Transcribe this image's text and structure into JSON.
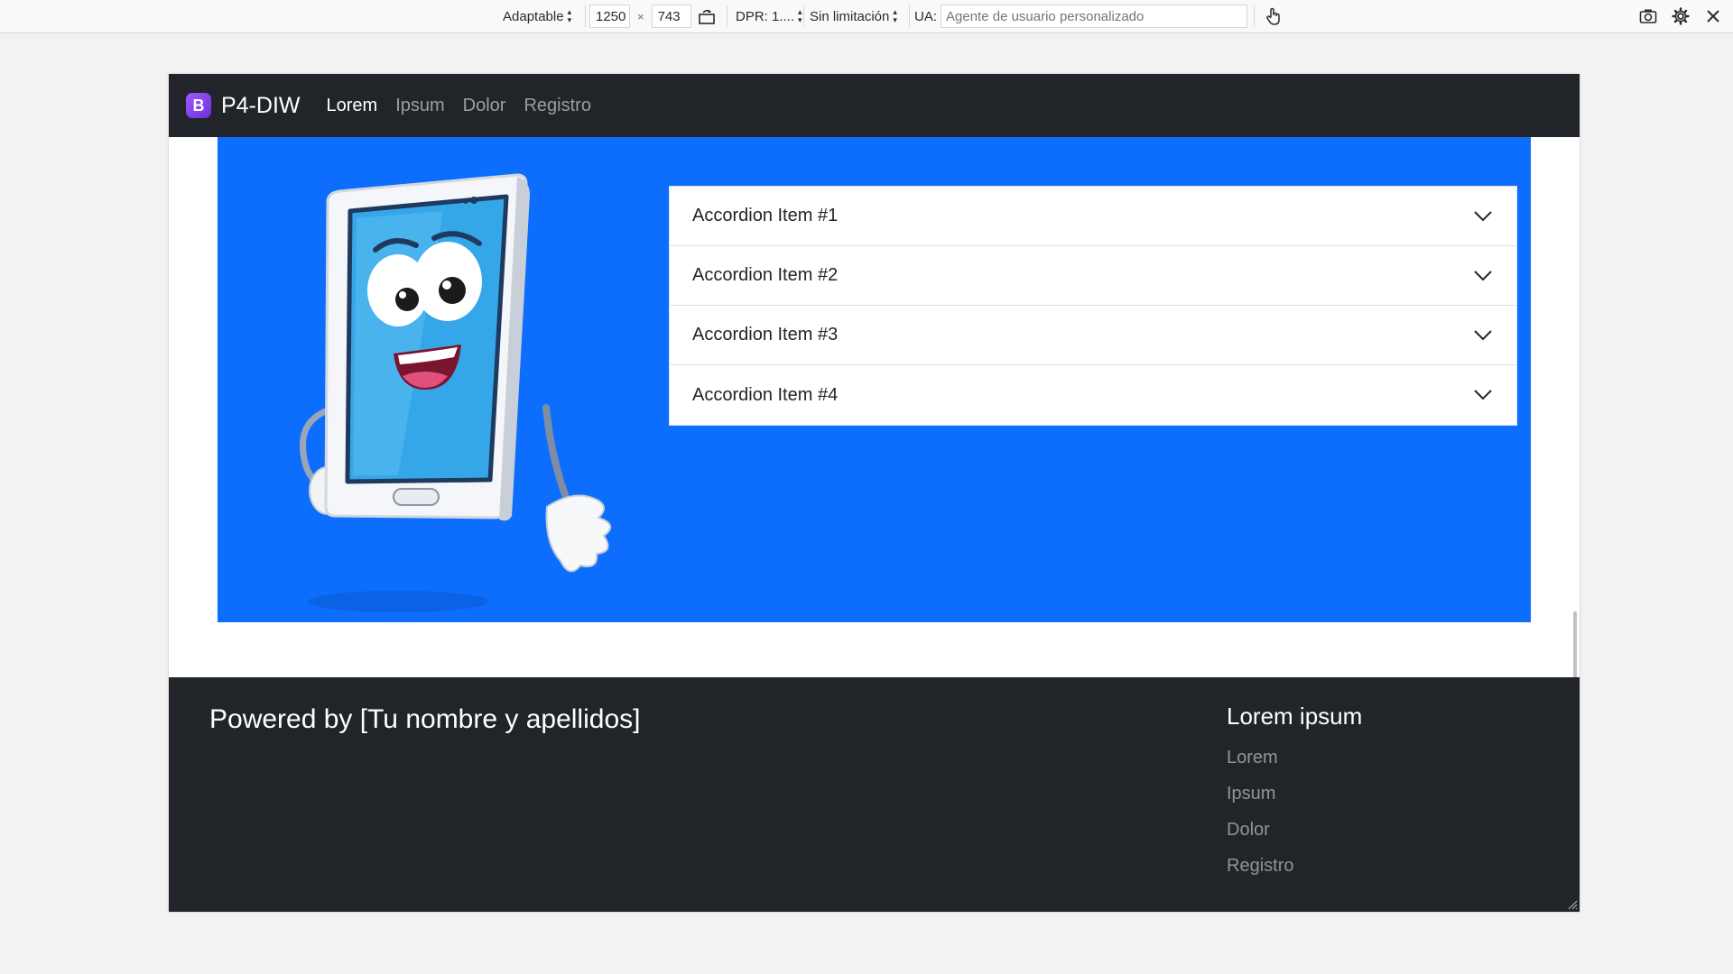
{
  "toolbar": {
    "device_mode": "Adaptable",
    "width": "1250",
    "times": "×",
    "height": "743",
    "dpr": "DPR: 1....",
    "throttling": "Sin limitación",
    "ua_label": "UA:",
    "ua_placeholder": "Agente de usuario personalizado",
    "icons": [
      "rotate-icon",
      "touch-icon",
      "screenshot-icon",
      "settings-icon",
      "close-icon"
    ]
  },
  "navbar": {
    "brand_logo": "B",
    "brand": "P4-DIW",
    "links": [
      {
        "label": "Lorem",
        "active": true
      },
      {
        "label": "Ipsum",
        "active": false
      },
      {
        "label": "Dolor",
        "active": false
      },
      {
        "label": "Registro",
        "active": false
      }
    ]
  },
  "hero": {
    "background": "#0d6efd",
    "accordion": [
      {
        "label": "Accordion Item #1"
      },
      {
        "label": "Accordion Item #2"
      },
      {
        "label": "Accordion Item #3"
      },
      {
        "label": "Accordion Item #4"
      }
    ]
  },
  "footer": {
    "powered": "Powered by [Tu nombre y apellidos]",
    "title": "Lorem ipsum",
    "links": [
      {
        "label": "Lorem"
      },
      {
        "label": "Ipsum"
      },
      {
        "label": "Dolor"
      },
      {
        "label": "Registro"
      }
    ]
  },
  "colors": {
    "navbar_bg": "#212529",
    "accent_blue": "#0d6efd",
    "brand_purple": "#7952f3"
  }
}
